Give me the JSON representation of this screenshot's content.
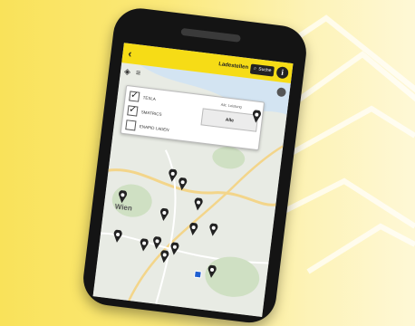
{
  "colors": {
    "accent": "#f6dc16",
    "background_yellow": "#f9e25a",
    "phone_body": "#141414",
    "pin": "#222222",
    "location": "#1f5fd1"
  },
  "app_bar": {
    "back_icon": "back-arrow-icon",
    "title": "Ladestellen",
    "search_label": "Suche",
    "search_icon": "search-icon",
    "info_icon": "info-icon"
  },
  "filter_panel": {
    "items": [
      {
        "label": "TESLA",
        "checked": true
      },
      {
        "label": "SMATRICS",
        "checked": true
      },
      {
        "label": "ENAPID LADEN",
        "checked": false
      }
    ],
    "right_caption": "Akt. Leistung",
    "all_button": "Alle"
  },
  "map": {
    "city_label": "Wien"
  }
}
